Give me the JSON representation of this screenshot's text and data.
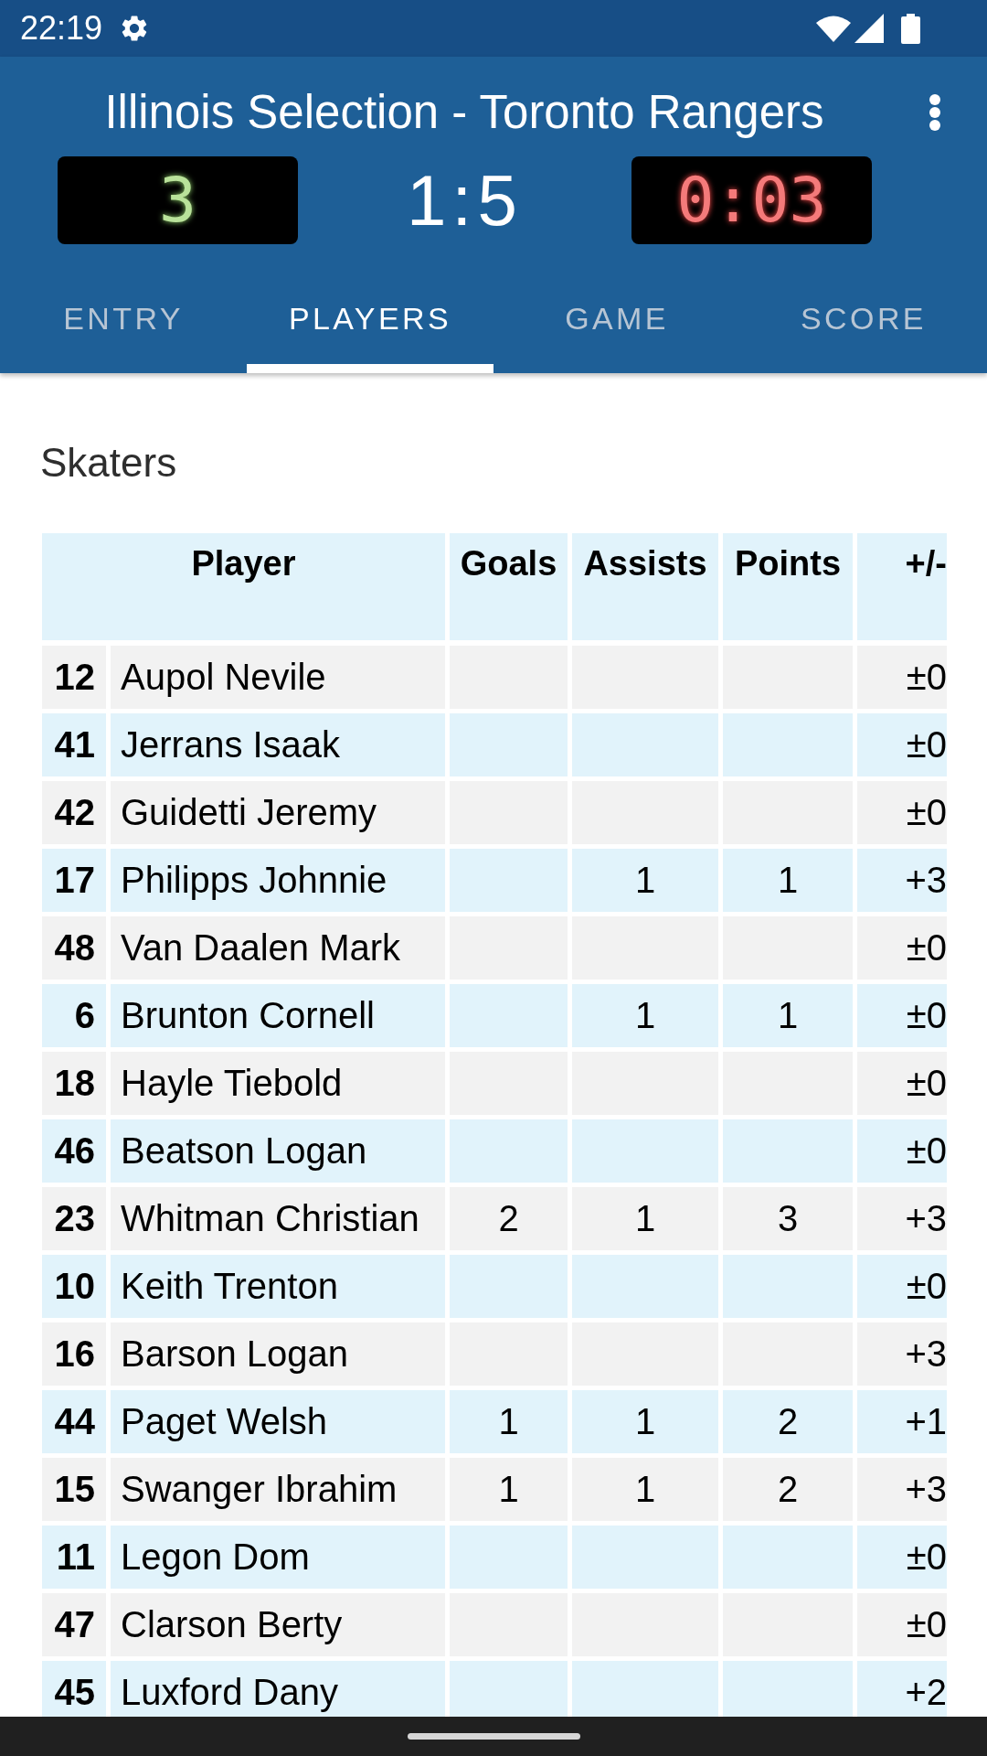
{
  "status_bar": {
    "time": "22:19"
  },
  "header": {
    "title": "Illinois Selection - Toronto Rangers",
    "period": "3",
    "score": "1:5",
    "clock": "0:03"
  },
  "tabs": [
    {
      "label": "ENTRY",
      "selected": false
    },
    {
      "label": "PLAYERS",
      "selected": true
    },
    {
      "label": "GAME",
      "selected": false
    },
    {
      "label": "SCORE",
      "selected": false
    }
  ],
  "section_title": "Skaters",
  "table": {
    "columns": [
      "Player",
      "Goals",
      "Assists",
      "Points",
      "+/-"
    ],
    "rows": [
      {
        "number": "12",
        "player": "Aupol Nevile",
        "plus_minus": "±0"
      },
      {
        "number": "41",
        "player": "Jerrans Isaak",
        "plus_minus": "±0"
      },
      {
        "number": "42",
        "player": "Guidetti Jeremy",
        "plus_minus": "±0"
      },
      {
        "number": "17",
        "player": "Philipps Johnnie",
        "assists": "1",
        "points": "1",
        "plus_minus": "+3"
      },
      {
        "number": "48",
        "player": "Van Daalen Mark",
        "plus_minus": "±0"
      },
      {
        "number": "6",
        "player": "Brunton Cornell",
        "assists": "1",
        "points": "1",
        "plus_minus": "±0"
      },
      {
        "number": "18",
        "player": "Hayle Tiebold",
        "plus_minus": "±0"
      },
      {
        "number": "46",
        "player": "Beatson Logan",
        "plus_minus": "±0"
      },
      {
        "number": "23",
        "player": "Whitman Christian",
        "goals": "2",
        "assists": "1",
        "points": "3",
        "plus_minus": "+3"
      },
      {
        "number": "10",
        "player": "Keith Trenton",
        "plus_minus": "±0"
      },
      {
        "number": "16",
        "player": "Barson Logan",
        "plus_minus": "+3"
      },
      {
        "number": "44",
        "player": "Paget Welsh",
        "goals": "1",
        "assists": "1",
        "points": "2",
        "plus_minus": "+1"
      },
      {
        "number": "15",
        "player": "Swanger Ibrahim",
        "goals": "1",
        "assists": "1",
        "points": "2",
        "plus_minus": "+3"
      },
      {
        "number": "11",
        "player": "Legon Dom",
        "plus_minus": "±0"
      },
      {
        "number": "47",
        "player": "Clarson Berty",
        "plus_minus": "±0"
      },
      {
        "number": "45",
        "player": "Luxford Dany",
        "plus_minus": "+2"
      }
    ]
  }
}
